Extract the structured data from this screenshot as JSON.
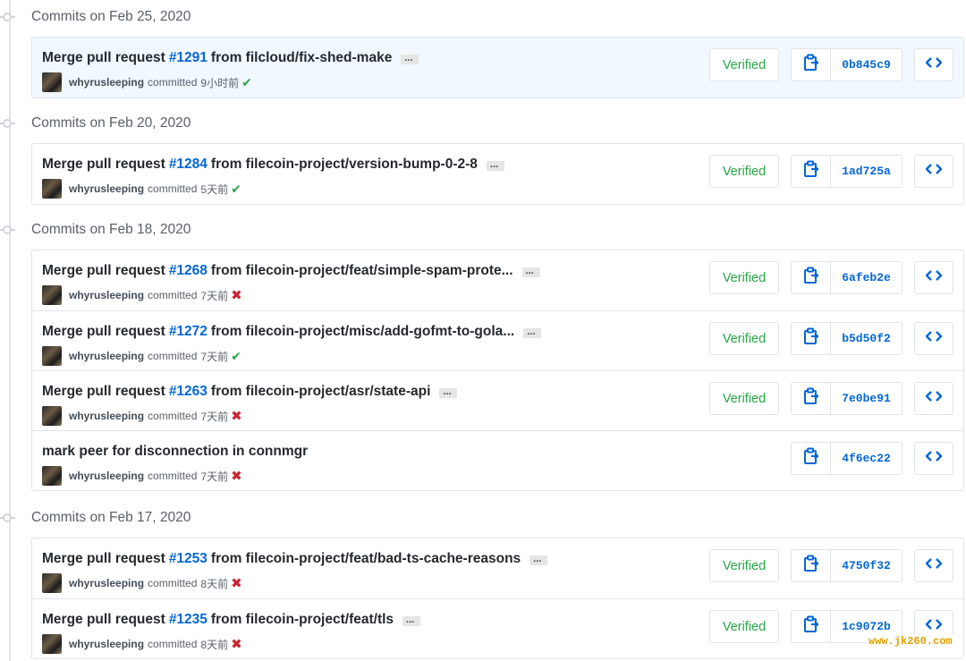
{
  "groups": [
    {
      "header": "Commits on Feb 25, 2020",
      "commits": [
        {
          "msg": "Merge pull request",
          "pr": "#1291",
          "rest": "from filcloud/fix-shed-make",
          "author": "whyrusleeping",
          "committed": "committed",
          "time": "9小时前",
          "status": "success",
          "verified": "Verified",
          "sha": "0b845c9"
        }
      ]
    },
    {
      "header": "Commits on Feb 20, 2020",
      "commits": [
        {
          "msg": "Merge pull request",
          "pr": "#1284",
          "rest": "from filecoin-project/version-bump-0-2-8",
          "author": "whyrusleeping",
          "committed": "committed",
          "time": "5天前",
          "status": "success",
          "verified": "Verified",
          "sha": "1ad725a"
        }
      ]
    },
    {
      "header": "Commits on Feb 18, 2020",
      "commits": [
        {
          "msg": "Merge pull request",
          "pr": "#1268",
          "rest": "from filecoin-project/feat/simple-spam-prote...",
          "author": "whyrusleeping",
          "committed": "committed",
          "time": "7天前",
          "status": "failure",
          "verified": "Verified",
          "sha": "6afeb2e"
        },
        {
          "msg": "Merge pull request",
          "pr": "#1272",
          "rest": "from filecoin-project/misc/add-gofmt-to-gola...",
          "author": "whyrusleeping",
          "committed": "committed",
          "time": "7天前",
          "status": "success",
          "verified": "Verified",
          "sha": "b5d50f2"
        },
        {
          "msg": "Merge pull request",
          "pr": "#1263",
          "rest": "from filecoin-project/asr/state-api",
          "author": "whyrusleeping",
          "committed": "committed",
          "time": "7天前",
          "status": "failure",
          "verified": "Verified",
          "sha": "7e0be91"
        },
        {
          "msg": "mark peer for disconnection in connmgr",
          "pr": "",
          "rest": "",
          "author": "whyrusleeping",
          "committed": "committed",
          "time": "7天前",
          "status": "failure",
          "verified": "",
          "sha": "4f6ec22"
        }
      ]
    },
    {
      "header": "Commits on Feb 17, 2020",
      "commits": [
        {
          "msg": "Merge pull request",
          "pr": "#1253",
          "rest": "from filecoin-project/feat/bad-ts-cache-reasons",
          "author": "whyrusleeping",
          "committed": "committed",
          "time": "8天前",
          "status": "failure",
          "verified": "Verified",
          "sha": "4750f32"
        },
        {
          "msg": "Merge pull request",
          "pr": "#1235",
          "rest": "from filecoin-project/feat/tls",
          "author": "whyrusleeping",
          "committed": "committed",
          "time": "8天前",
          "status": "failure",
          "verified": "Verified",
          "sha": "1c9072b"
        }
      ]
    }
  ],
  "watermark": "www.jk260.com",
  "colors": {
    "link": "#0366d6",
    "success": "#28a745",
    "failure": "#cb2431",
    "border": "#e1e4e8",
    "highlight": "#f1f8ff"
  },
  "icons": {
    "copy": "clippy-icon",
    "browse": "code-icon",
    "success": "check-icon",
    "failure": "x-icon",
    "node": "git-commit-icon"
  }
}
